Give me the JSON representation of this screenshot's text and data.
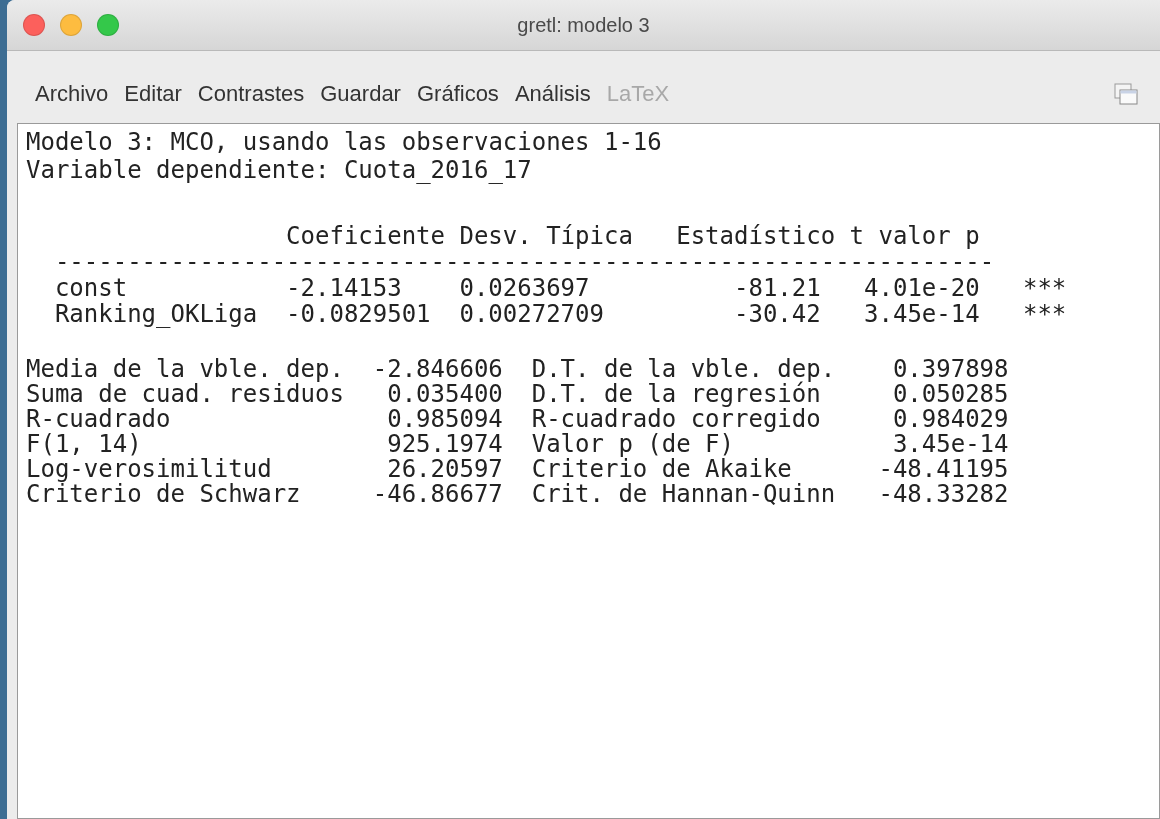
{
  "window": {
    "title": "gretl: modelo 3"
  },
  "menu": [
    {
      "label": "Archivo",
      "disabled": false
    },
    {
      "label": "Editar",
      "disabled": false
    },
    {
      "label": "Contrastes",
      "disabled": false
    },
    {
      "label": "Guardar",
      "disabled": false
    },
    {
      "label": "Gráficos",
      "disabled": false
    },
    {
      "label": "Análisis",
      "disabled": false
    },
    {
      "label": "LaTeX",
      "disabled": true
    }
  ],
  "output": {
    "heading": [
      "Modelo 3: MCO, usando las observaciones 1-16",
      "Variable dependiente: Cuota_2016_17"
    ],
    "coefficients": {
      "columns": [
        "Coeficiente",
        "Desv. Típica",
        "Estadístico t",
        "valor p"
      ],
      "rule": "-----------------------------------------------------------------",
      "rows": [
        {
          "name": "const",
          "cells": [
            "-2.14153",
            "0.0263697",
            "-81.21",
            "4.01e-20"
          ],
          "stars": "***"
        },
        {
          "name": "Ranking_OKLiga",
          "cells": [
            "-0.0829501",
            "0.00272709",
            "-30.42",
            "3.45e-14"
          ],
          "stars": "***"
        }
      ]
    },
    "stats": [
      [
        "Media de la vble. dep.",
        "-2.846606",
        "D.T. de la vble. dep.",
        "0.397898"
      ],
      [
        "Suma de cuad. residuos",
        "0.035400",
        "D.T. de la regresión",
        "0.050285"
      ],
      [
        "R-cuadrado",
        "0.985094",
        "R-cuadrado corregido",
        "0.984029"
      ],
      [
        "F(1, 14)",
        "925.1974",
        "Valor p (de F)",
        "3.45e-14"
      ],
      [
        "Log-verosimilitud",
        "26.20597",
        "Criterio de Akaike",
        "-48.41195"
      ],
      [
        "Criterio de Schwarz",
        "-46.86677",
        "Crit. de Hannan-Quinn",
        "-48.33282"
      ]
    ]
  }
}
